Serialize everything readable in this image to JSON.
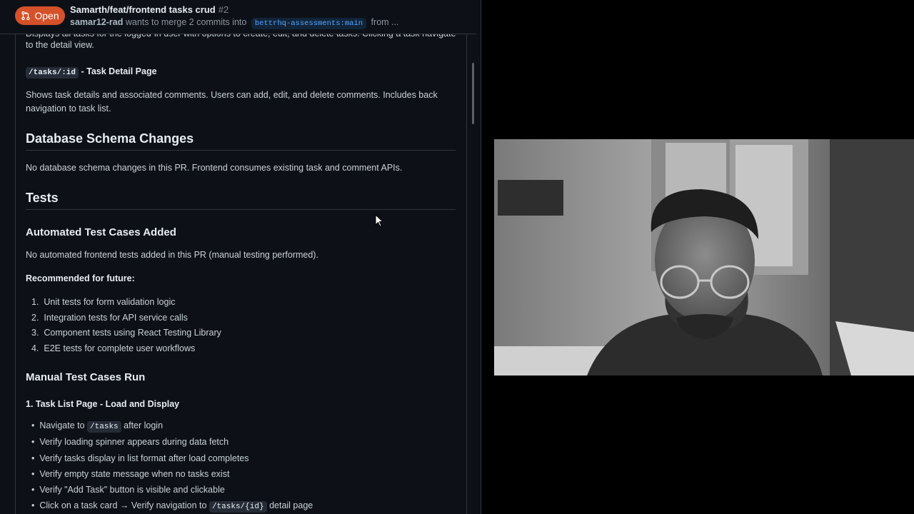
{
  "pr": {
    "state": "Open",
    "title": "Samarth/feat/frontend tasks crud",
    "number": "#2",
    "author": "samar12-rad",
    "merge_text": "wants to merge 2 commits into",
    "base_branch": "bettrhq-assessments:main",
    "from_text": "from ..."
  },
  "description": {
    "cut_line": "Displays all tasks for the logged-in user with options to create, edit, and delete tasks. Clicking a task navigates",
    "detail_view_line": "to the detail view.",
    "route_code": "/tasks/:id",
    "route_label": " - Task Detail Page",
    "route_desc_1": "Shows task details and associated comments. Users can add, edit, and delete comments. Includes back",
    "route_desc_2": "navigation to task list.",
    "db_heading": "Database Schema Changes",
    "db_text": "No database schema changes in this PR. Frontend consumes existing task and comment APIs.",
    "tests_heading": "Tests",
    "auto_heading": "Automated Test Cases Added",
    "auto_text": "No automated frontend tests added in this PR (manual testing performed).",
    "recommended_label": "Recommended for future:",
    "recommended_items": [
      "Unit tests for form validation logic",
      "Integration tests for API service calls",
      "Component tests using React Testing Library",
      "E2E tests for complete user workflows"
    ],
    "manual_heading": "Manual Test Cases Run",
    "case1_heading": "1. Task List Page - Load and Display",
    "case1_nav_pre": "Navigate to",
    "case1_nav_code": "/tasks",
    "case1_nav_post": "after login",
    "case1_items": [
      "Verify loading spinner appears during data fetch",
      "Verify tasks display in list format after load completes",
      "Verify empty state message when no tasks exist",
      "Verify \"Add Task\" button is visible and clickable"
    ],
    "case1_click_pre": "Click on a task card → Verify navigation to",
    "case1_click_code": "/tasks/{id}",
    "case1_click_post": "detail page"
  },
  "colors": {
    "open_badge": "#d4512a",
    "bg": "#0d1117",
    "link": "#58a6ff"
  },
  "icons": {
    "state_icon": "git-pull-request-icon",
    "cursor": "mouse-pointer-icon"
  }
}
